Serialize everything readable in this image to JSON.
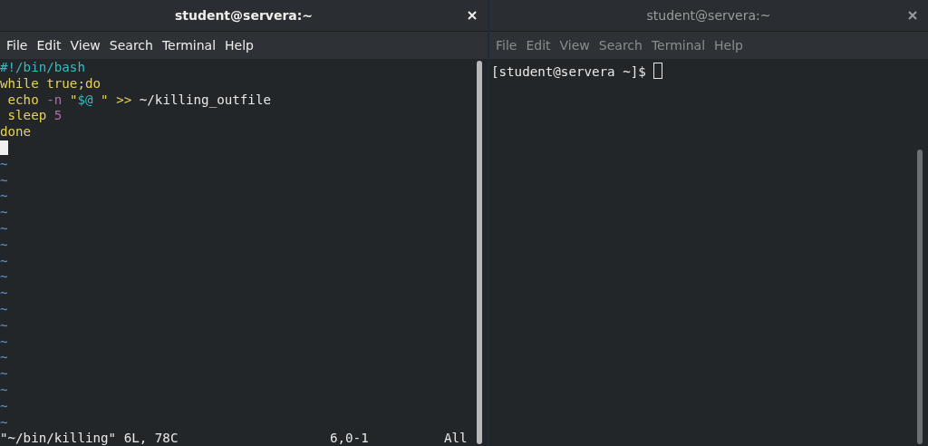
{
  "windows": [
    {
      "title": "student@servera:~",
      "focused": true,
      "menu": [
        "File",
        "Edit",
        "View",
        "Search",
        "Terminal",
        "Help"
      ],
      "kind": "vim",
      "lines": [
        [
          {
            "text": "#!/bin/bash",
            "kind": "comment"
          }
        ],
        [
          {
            "text": "while true;do",
            "kind": "keyword"
          }
        ],
        [
          {
            "text": " echo ",
            "kind": "keyword"
          },
          {
            "text": "-n ",
            "kind": "number"
          },
          {
            "text": "\"",
            "kind": "keyword"
          },
          {
            "text": "$@",
            "kind": "comment"
          },
          {
            "text": " \" >>",
            "kind": "keyword"
          },
          {
            "text": " ~/killing_outfile",
            "kind": "plain"
          }
        ],
        [
          {
            "text": " sleep ",
            "kind": "keyword"
          },
          {
            "text": "5",
            "kind": "number"
          }
        ],
        [
          {
            "text": "done",
            "kind": "keyword"
          }
        ]
      ],
      "tildes": [
        "~",
        "~",
        "~",
        "~",
        "~",
        "~",
        "~",
        "~",
        "~",
        "~",
        "~",
        "~",
        "~",
        "~",
        "~",
        "~",
        "~"
      ],
      "status": {
        "message": "\"~/bin/killing\" 6L, 78C",
        "position": "6,0-1",
        "scroll": "All"
      }
    },
    {
      "title": "student@servera:~",
      "focused": false,
      "menu": [
        "File",
        "Edit",
        "View",
        "Search",
        "Terminal",
        "Help"
      ],
      "kind": "shell",
      "prompt": "[student@servera ~]$"
    }
  ]
}
